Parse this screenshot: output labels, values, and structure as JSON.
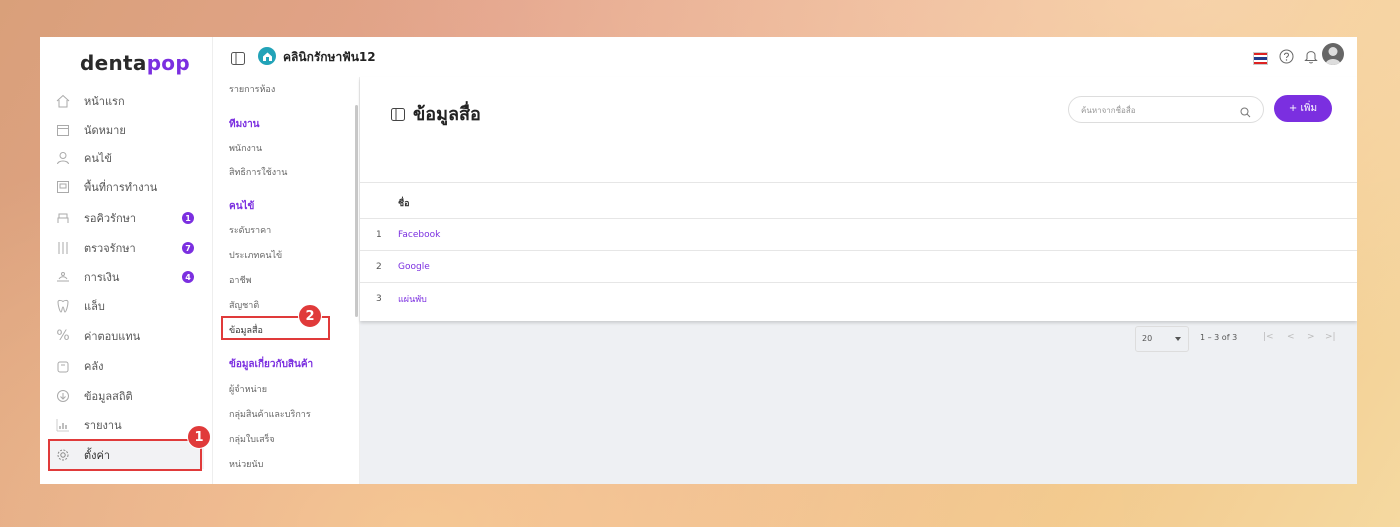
{
  "brand": {
    "logo_dark": "denta",
    "logo_accent": "pop"
  },
  "header": {
    "clinic_name": "คลินิกรักษาฟัน12"
  },
  "sidebar": {
    "items": [
      {
        "label": "หน้าแรก",
        "icon": "home-icon"
      },
      {
        "label": "นัดหมาย",
        "icon": "calendar-icon"
      },
      {
        "label": "คนไข้",
        "icon": "user-icon"
      },
      {
        "label": "พื้นที่การทำงาน",
        "icon": "workspace-icon"
      },
      {
        "label": "รอคิวรักษา",
        "icon": "chair-icon",
        "badge": "1"
      },
      {
        "label": "ตรวจรักษา",
        "icon": "tools-icon",
        "badge": "7"
      },
      {
        "label": "การเงิน",
        "icon": "money-icon",
        "badge": "4"
      },
      {
        "label": "แล็บ",
        "icon": "tooth-icon"
      },
      {
        "label": "ค่าตอบแทน",
        "icon": "percent-icon"
      },
      {
        "label": "คลัง",
        "icon": "box-icon"
      },
      {
        "label": "ข้อมูลสถิติ",
        "icon": "download-icon"
      },
      {
        "label": "รายงาน",
        "icon": "chart-icon"
      },
      {
        "label": "ตั้งค่า",
        "icon": "gear-icon"
      }
    ]
  },
  "submenu": {
    "top_item": "รายการห้อง",
    "section_team": "ทีมงาน",
    "team_items": [
      "พนักงาน",
      "สิทธิการใช้งาน"
    ],
    "section_patient": "คนไข้",
    "patient_items": [
      "ระดับราคา",
      "ประเภทคนไข้",
      "อาชีพ",
      "สัญชาติ",
      "ข้อมูลสื่อ"
    ],
    "section_product": "ข้อมูลเกี่ยวกับสินค้า",
    "product_items": [
      "ผู้จำหน่าย",
      "กลุ่มสินค้าและบริการ",
      "กลุ่มใบเสร็จ",
      "หน่วยนับ"
    ]
  },
  "page": {
    "title": "ข้อมูลสื่อ",
    "search_placeholder": "ค้นหาจากชื่อสื่อ",
    "add_label": "+ เพิ่ม",
    "column_name": "ชื่อ",
    "rows": [
      {
        "num": "1",
        "name": "Facebook"
      },
      {
        "num": "2",
        "name": "Google"
      },
      {
        "num": "3",
        "name": "แผ่นพับ"
      }
    ],
    "page_size": "20",
    "range_text": "1 – 3 of 3"
  },
  "callouts": {
    "one": "1",
    "two": "2"
  },
  "colors": {
    "accent": "#7b2fe0",
    "callout": "#e03a3a"
  }
}
